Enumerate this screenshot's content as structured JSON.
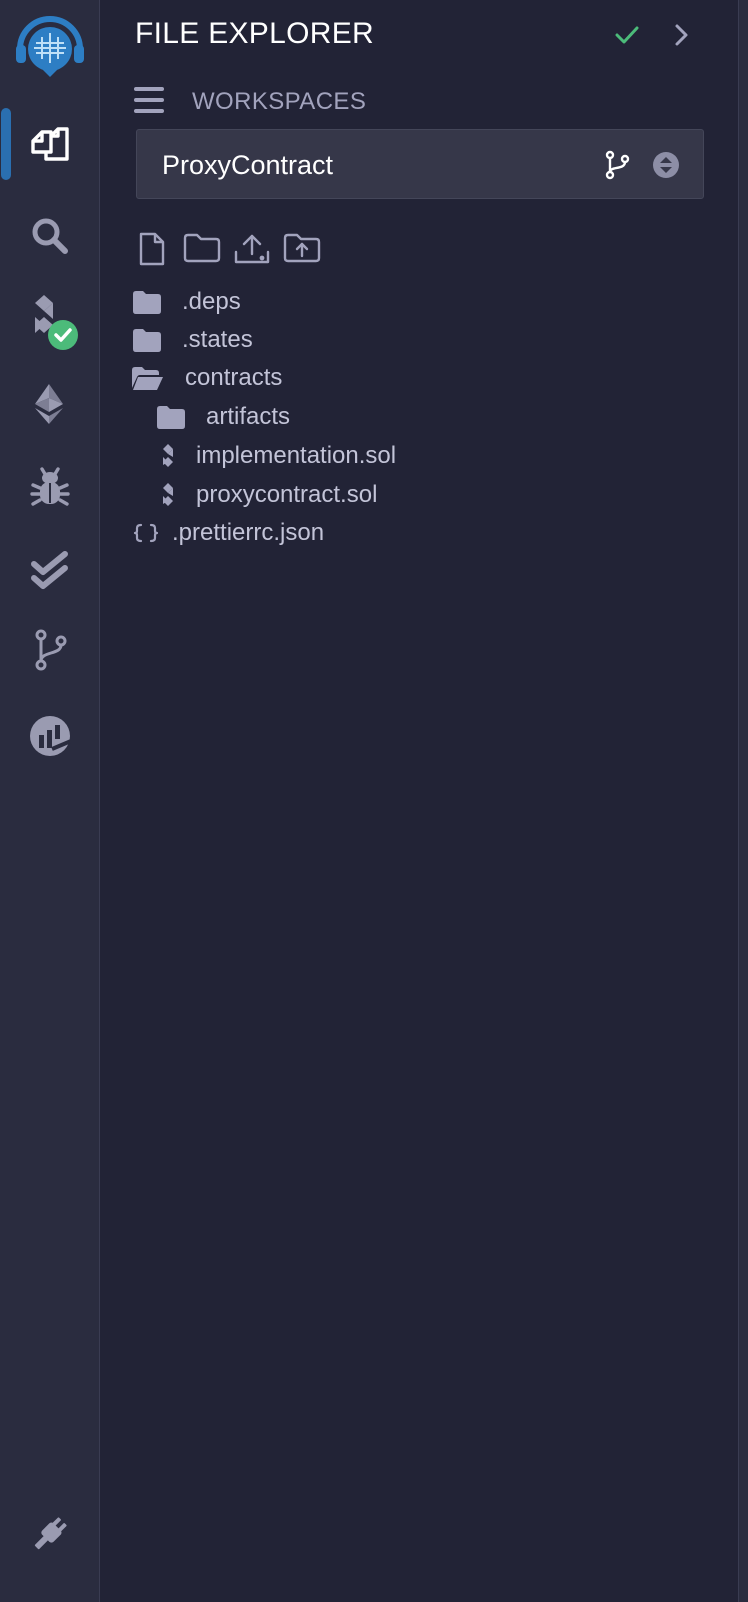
{
  "panel": {
    "title": "FILE EXPLORER",
    "workspaces_label": "WORKSPACES",
    "selected_workspace": "ProxyContract"
  },
  "sidebar": {
    "icons": [
      "remix-logo-icon",
      "file-explorer-icon",
      "search-icon",
      "solidity-compiler-icon",
      "deploy-run-icon",
      "debugger-icon",
      "solidity-unit-testing-icon",
      "git-icon",
      "analysis-icon",
      "plugin-manager-icon"
    ],
    "active": "file-explorer-icon"
  },
  "toolbar": {
    "icons": [
      "new-file-icon",
      "new-folder-icon",
      "upload-file-icon",
      "upload-folder-icon"
    ]
  },
  "tree": [
    {
      "label": ".deps",
      "type": "folder",
      "depth": 0
    },
    {
      "label": ".states",
      "type": "folder",
      "depth": 0
    },
    {
      "label": "contracts",
      "type": "folder-open",
      "depth": 0
    },
    {
      "label": "artifacts",
      "type": "folder",
      "depth": 1
    },
    {
      "label": "implementation.sol",
      "type": "solidity-file",
      "depth": 1
    },
    {
      "label": "proxycontract.sol",
      "type": "solidity-file",
      "depth": 1
    },
    {
      "label": ".prettierrc.json",
      "type": "json-file",
      "depth": 0
    }
  ],
  "colors": {
    "background": "#222336",
    "sidebar": "#2a2c3f",
    "accent_blue": "#2a6fb0",
    "success_green": "#4cbb7a",
    "text": "#c3c4d8",
    "muted": "#a2a3bd"
  }
}
